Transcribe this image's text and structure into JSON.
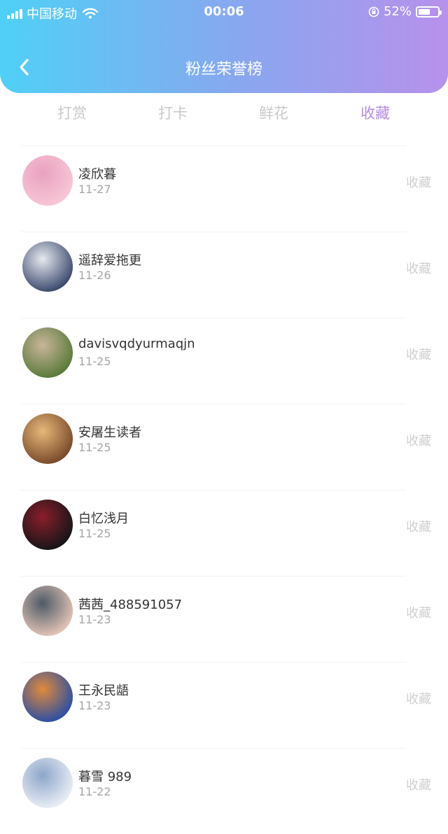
{
  "status_bar": {
    "carrier": "中国移动",
    "time": "00:06",
    "battery": "52%",
    "battery_level": 0.52
  },
  "header": {
    "title": "粉丝荣誉榜"
  },
  "tabs": [
    {
      "label": "打赏",
      "active": false
    },
    {
      "label": "打卡",
      "active": false
    },
    {
      "label": "鲜花",
      "active": false
    },
    {
      "label": "收藏",
      "active": true
    }
  ],
  "fans": [
    {
      "name": "凌欣暮",
      "date": "11-27",
      "tag": "收藏",
      "avatar_colors": [
        "#f7c6d6",
        "#e9a2c0"
      ]
    },
    {
      "name": "遥辞爱拖更",
      "date": "11-26",
      "tag": "收藏",
      "avatar_colors": [
        "#3c4a6e",
        "#e6e9ef"
      ]
    },
    {
      "name": "davisvqdyurmaqjn",
      "date": "11-25",
      "tag": "收藏",
      "avatar_colors": [
        "#5a7a3a",
        "#c9b59a"
      ]
    },
    {
      "name": "安屠生读者",
      "date": "11-25",
      "tag": "收藏",
      "avatar_colors": [
        "#7a4a2a",
        "#e7b87a"
      ]
    },
    {
      "name": "白忆浅月",
      "date": "11-25",
      "tag": "收藏",
      "avatar_colors": [
        "#151518",
        "#8a1e2a"
      ]
    },
    {
      "name": "茜茜_488591057",
      "date": "11-23",
      "tag": "收藏",
      "avatar_colors": [
        "#e3c3b6",
        "#4d5b66"
      ]
    },
    {
      "name": "王永民龉",
      "date": "11-23",
      "tag": "收藏",
      "avatar_colors": [
        "#2c4fa3",
        "#e08a3a"
      ]
    },
    {
      "name": "暮雪 989",
      "date": "11-22",
      "tag": "收藏",
      "avatar_colors": [
        "#e9eef5",
        "#8da6c9"
      ]
    }
  ],
  "colors": {
    "active_tab": "#b38be0",
    "inactive_tab": "#c9c9c9",
    "header_start": "#4fd0f7",
    "header_end": "#b791ec"
  }
}
